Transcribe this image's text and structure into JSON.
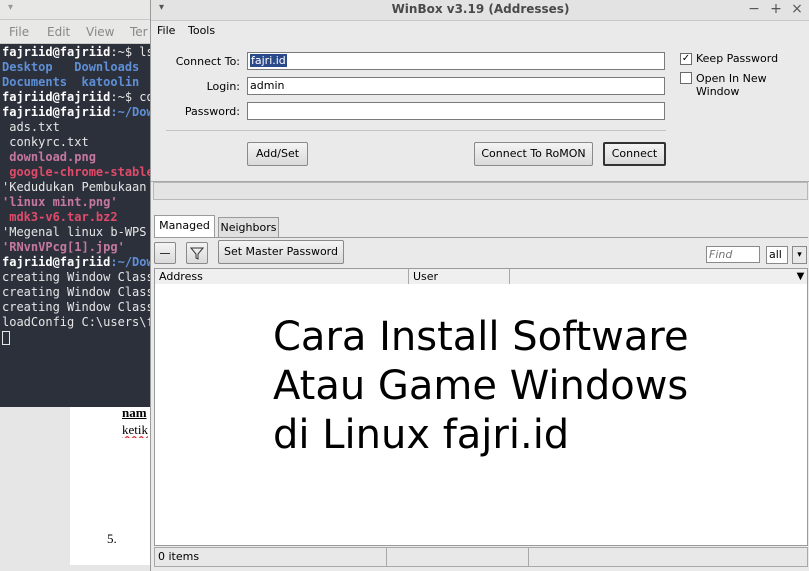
{
  "terminal": {
    "menu": [
      "File",
      "Edit",
      "View",
      "Ter"
    ],
    "lines": [
      {
        "parts": [
          {
            "t": "fajriid@fajriid",
            "c": "c-prompt"
          },
          {
            "t": ":~$ ls",
            "c": "c-file"
          }
        ]
      },
      {
        "parts": [
          {
            "t": "Desktop   Downloads",
            "c": "c-dir"
          }
        ]
      },
      {
        "parts": [
          {
            "t": "Documents  katoolin",
            "c": "c-dir"
          }
        ]
      },
      {
        "parts": [
          {
            "t": "fajriid@fajriid",
            "c": "c-prompt"
          },
          {
            "t": ":~$ cd",
            "c": "c-file"
          }
        ]
      },
      {
        "parts": [
          {
            "t": "fajriid@fajriid",
            "c": "c-prompt"
          },
          {
            "t": ":~/Dow",
            "c": "c-dir"
          }
        ]
      },
      {
        "parts": [
          {
            "t": " ads.txt",
            "c": "c-file"
          }
        ]
      },
      {
        "parts": [
          {
            "t": " conkyrc.txt",
            "c": "c-file"
          }
        ]
      },
      {
        "parts": [
          {
            "t": " download.png",
            "c": "c-img"
          }
        ]
      },
      {
        "parts": [
          {
            "t": " google-chrome-stable",
            "c": "c-arch"
          }
        ]
      },
      {
        "parts": [
          {
            "t": "'Kedudukan Pembukaan",
            "c": "c-file"
          }
        ]
      },
      {
        "parts": [
          {
            "t": "'linux mint.png'",
            "c": "c-quote-img"
          }
        ]
      },
      {
        "parts": [
          {
            "t": " mdk3-v6.tar.bz2",
            "c": "c-arch"
          }
        ]
      },
      {
        "parts": [
          {
            "t": "'Megenal linux b-WPS",
            "c": "c-file"
          }
        ]
      },
      {
        "parts": [
          {
            "t": "'RNvnVPcg[1].jpg'",
            "c": "c-quote-img"
          }
        ]
      },
      {
        "parts": [
          {
            "t": "fajriid@fajriid",
            "c": "c-prompt"
          },
          {
            "t": ":~/Dow",
            "c": "c-dir"
          }
        ]
      },
      {
        "parts": [
          {
            "t": "creating Window Class",
            "c": "c-file"
          }
        ]
      },
      {
        "parts": [
          {
            "t": "creating Window Class",
            "c": "c-file"
          }
        ]
      },
      {
        "parts": [
          {
            "t": "creating Window Class",
            "c": "c-file"
          }
        ]
      },
      {
        "parts": [
          {
            "t": "loadConfig C:\\users\\f",
            "c": "c-file"
          }
        ]
      }
    ]
  },
  "document": {
    "line1": "nam",
    "line2": "ketik",
    "list_number": "5."
  },
  "winbox": {
    "title": "WinBox v3.19 (Addresses)",
    "menu": {
      "file": "File",
      "tools": "Tools"
    },
    "connect_to_label": "Connect To:",
    "connect_to_value": "fajri.id",
    "login_label": "Login:",
    "login_value": "admin",
    "password_label": "Password:",
    "password_value": "",
    "keep_password_label": "Keep Password",
    "keep_password_checked": true,
    "open_new_window_label": "Open In New Window",
    "open_new_window_checked": false,
    "add_set_button": "Add/Set",
    "connect_romon_button": "Connect To RoMON",
    "connect_button": "Connect",
    "tabs": [
      "Managed",
      "Neighbors"
    ],
    "set_master_password_button": "Set Master Password",
    "find_placeholder": "Find",
    "filter_value": "all",
    "columns": [
      "Address",
      "User"
    ],
    "overlay_text": "Cara Install Software\nAtau Game Windows\ndi Linux fajri.id",
    "status_items": "0 items"
  }
}
